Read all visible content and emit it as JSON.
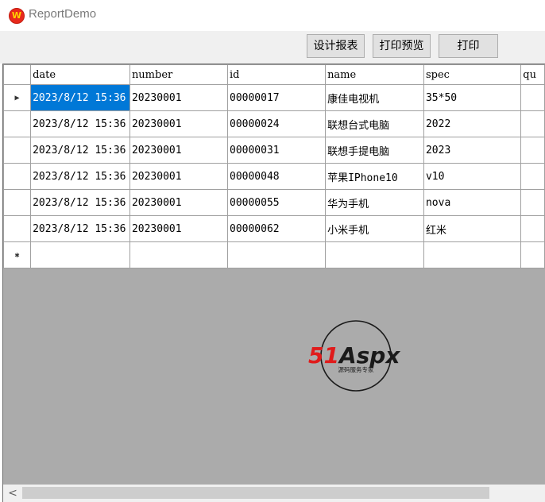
{
  "window": {
    "title": "ReportDemo",
    "icon": "app-logo-icon"
  },
  "toolbar": {
    "design_label": "设计报表",
    "preview_label": "打印预览",
    "print_label": "打印"
  },
  "grid": {
    "columns": [
      "date",
      "number",
      "id",
      "name",
      "spec",
      "qu"
    ],
    "rows": [
      {
        "date": "2023/8/12 15:36",
        "number": "20230001",
        "id": "00000017",
        "name": "康佳电视机",
        "spec": "35*50"
      },
      {
        "date": "2023/8/12 15:36",
        "number": "20230001",
        "id": "00000024",
        "name": "联想台式电脑",
        "spec": "2022"
      },
      {
        "date": "2023/8/12 15:36",
        "number": "20230001",
        "id": "00000031",
        "name": "联想手提电脑",
        "spec": "2023"
      },
      {
        "date": "2023/8/12 15:36",
        "number": "20230001",
        "id": "00000048",
        "name": "苹果IPhone10",
        "spec": "v10"
      },
      {
        "date": "2023/8/12 15:36",
        "number": "20230001",
        "id": "00000055",
        "name": "华为手机",
        "spec": "nova"
      },
      {
        "date": "2023/8/12 15:36",
        "number": "20230001",
        "id": "00000062",
        "name": "小米手机",
        "spec": "红米"
      }
    ],
    "current_row_marker": "▶",
    "new_row_marker": "✱",
    "selection_color": "#0078d7"
  },
  "watermark": {
    "brand": "51Aspx",
    "tagline": "源码服务专家",
    "brand_red": "#e01b1b",
    "brand_green": "#2ea043"
  },
  "scrollbar": {
    "left_arrow": "<"
  }
}
